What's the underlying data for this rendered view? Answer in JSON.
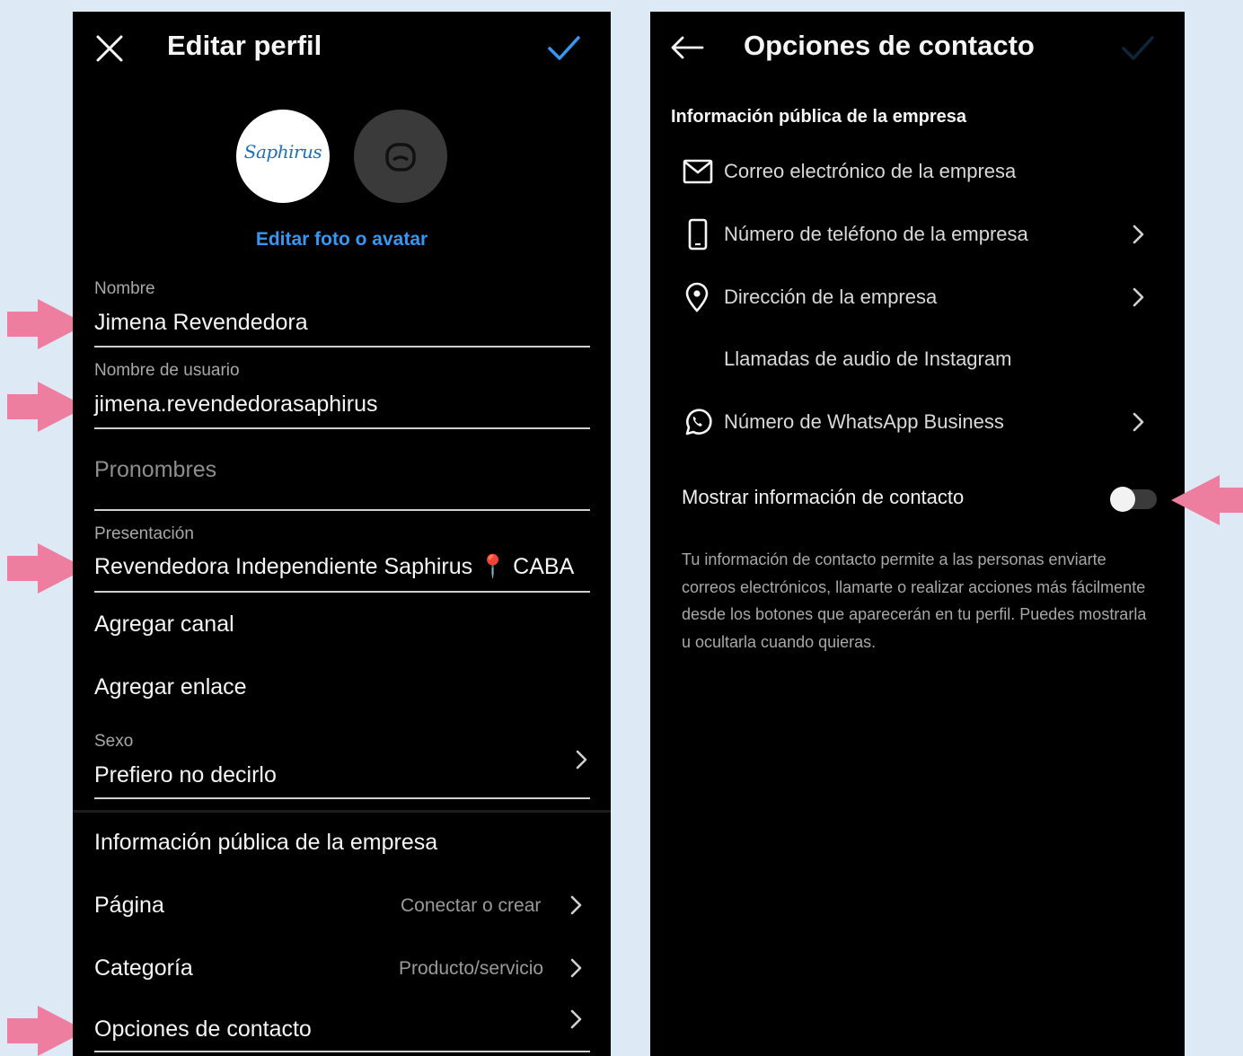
{
  "colors": {
    "background": "#dde9f5",
    "phone_bg": "#000000",
    "accent_blue": "#3897f0",
    "arrow_pink": "#ee7e9f",
    "toggle_off_track": "#3b3b3b"
  },
  "edit_profile": {
    "title": "Editar perfil",
    "close_icon": "close-icon",
    "confirm_icon": "checkmark-icon",
    "avatar_logo_text": "Saphirus",
    "edit_photo_link": "Editar foto o avatar",
    "fields": {
      "name": {
        "label": "Nombre",
        "value": "Jimena Revendedora"
      },
      "username": {
        "label": "Nombre de usuario",
        "value": "jimena.revendedorasaphirus"
      },
      "pronouns": {
        "placeholder": "Pronombres"
      },
      "bio": {
        "label": "Presentación",
        "value": "Revendedora Independiente Saphirus 📍 CABA"
      },
      "gender": {
        "label": "Sexo",
        "value": "Prefiero no decirlo"
      }
    },
    "add_channel": "Agregar canal",
    "add_link": "Agregar enlace",
    "business_section": "Información pública de la empresa",
    "page_row": {
      "label": "Página",
      "value": "Conectar o crear"
    },
    "category_row": {
      "label": "Categoría",
      "value": "Producto/servicio"
    },
    "contact_options_row": {
      "label": "Opciones de contacto"
    }
  },
  "contact_options": {
    "title": "Opciones de contacto",
    "back_icon": "back-arrow-icon",
    "confirm_icon": "checkmark-icon",
    "section_title": "Información pública de la empresa",
    "items": [
      {
        "icon": "mail-icon",
        "label": "Correo electrónico de la empresa"
      },
      {
        "icon": "phone-icon",
        "label": "Número de teléfono de la empresa"
      },
      {
        "icon": "location-pin-icon",
        "label": "Dirección de la empresa"
      },
      {
        "icon": "",
        "label": "Llamadas de audio de Instagram"
      },
      {
        "icon": "whatsapp-icon",
        "label": "Número de WhatsApp Business"
      }
    ],
    "toggle": {
      "label": "Mostrar información de contacto",
      "on": false
    },
    "description": "Tu información de contacto permite a las personas enviarte correos electrónicos, llamarte o realizar acciones más fácilmente desde los botones que aparecerán en tu perfil. Puedes mostrarla u ocultarla cuando quieras."
  }
}
